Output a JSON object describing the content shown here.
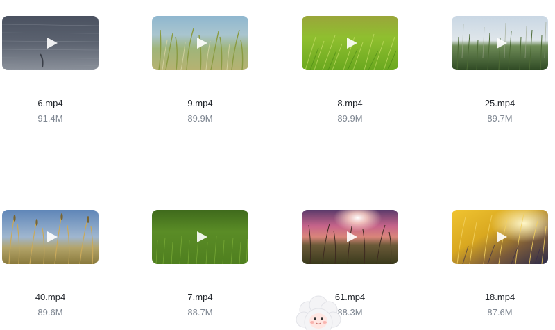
{
  "videos": [
    {
      "name": "6.mp4",
      "size": "91.4M",
      "thumbnail": "water-surface"
    },
    {
      "name": "9.mp4",
      "size": "89.9M",
      "thumbnail": "grass-by-water"
    },
    {
      "name": "8.mp4",
      "size": "89.9M",
      "thumbnail": "bright-green-grass"
    },
    {
      "name": "25.mp4",
      "size": "89.7M",
      "thumbnail": "grass-under-sky"
    },
    {
      "name": "40.mp4",
      "size": "89.6M",
      "thumbnail": "reeds-blue-sky"
    },
    {
      "name": "7.mp4",
      "size": "88.7M",
      "thumbnail": "green-lawn"
    },
    {
      "name": "61.mp4",
      "size": "88.3M",
      "thumbnail": "sunset-meadow"
    },
    {
      "name": "18.mp4",
      "size": "87.6M",
      "thumbnail": "golden-sunlit-grass"
    }
  ],
  "mascot": {
    "icon": "sheep-mascot-icon"
  }
}
